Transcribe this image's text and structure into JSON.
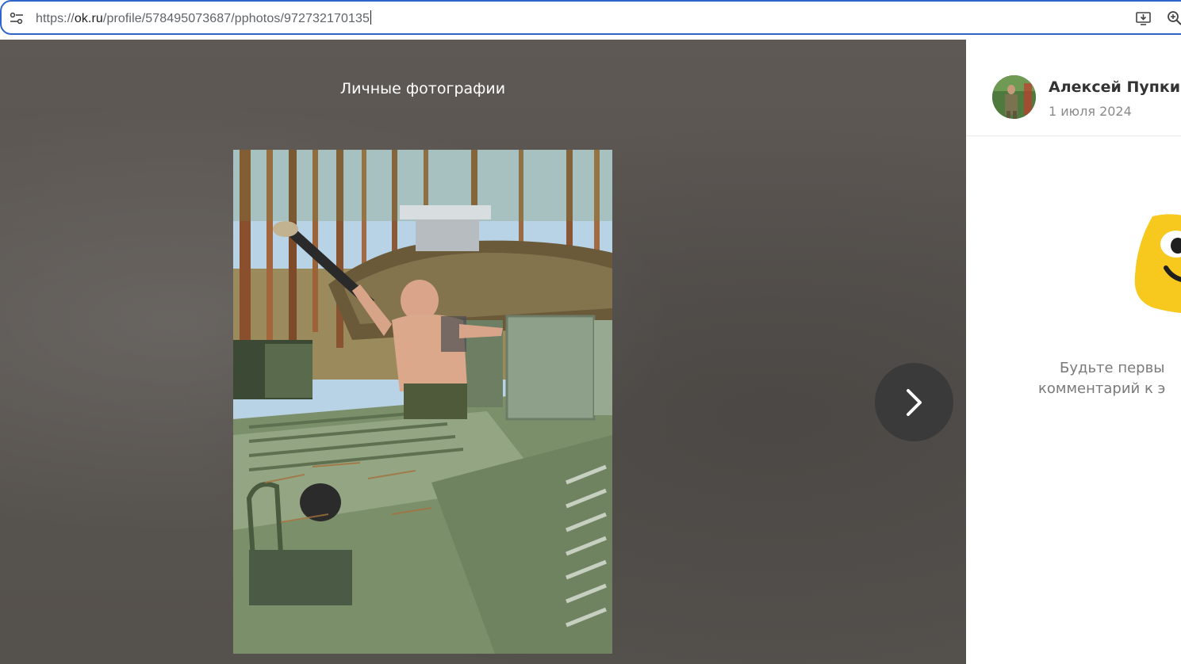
{
  "browser": {
    "url_prefix": "https://",
    "url_host": "ok.ru",
    "url_path": "/profile/578495073687/pphotos/972732170135",
    "icons": [
      "site-settings-icon",
      "install-app-icon",
      "zoom-icon"
    ]
  },
  "viewer": {
    "album_title": "Личные фотографии",
    "next_icon": "chevron-right-icon"
  },
  "side_panel": {
    "author_name": "Алексей Пупкин",
    "date": "1 июля 2024",
    "empty_line1": "Будьте первы",
    "empty_line2": "комментарий к э"
  },
  "colors": {
    "viewer_bg": "#5a5551",
    "accent_yellow": "#f7c81e",
    "url_focus": "#2f64c8"
  }
}
